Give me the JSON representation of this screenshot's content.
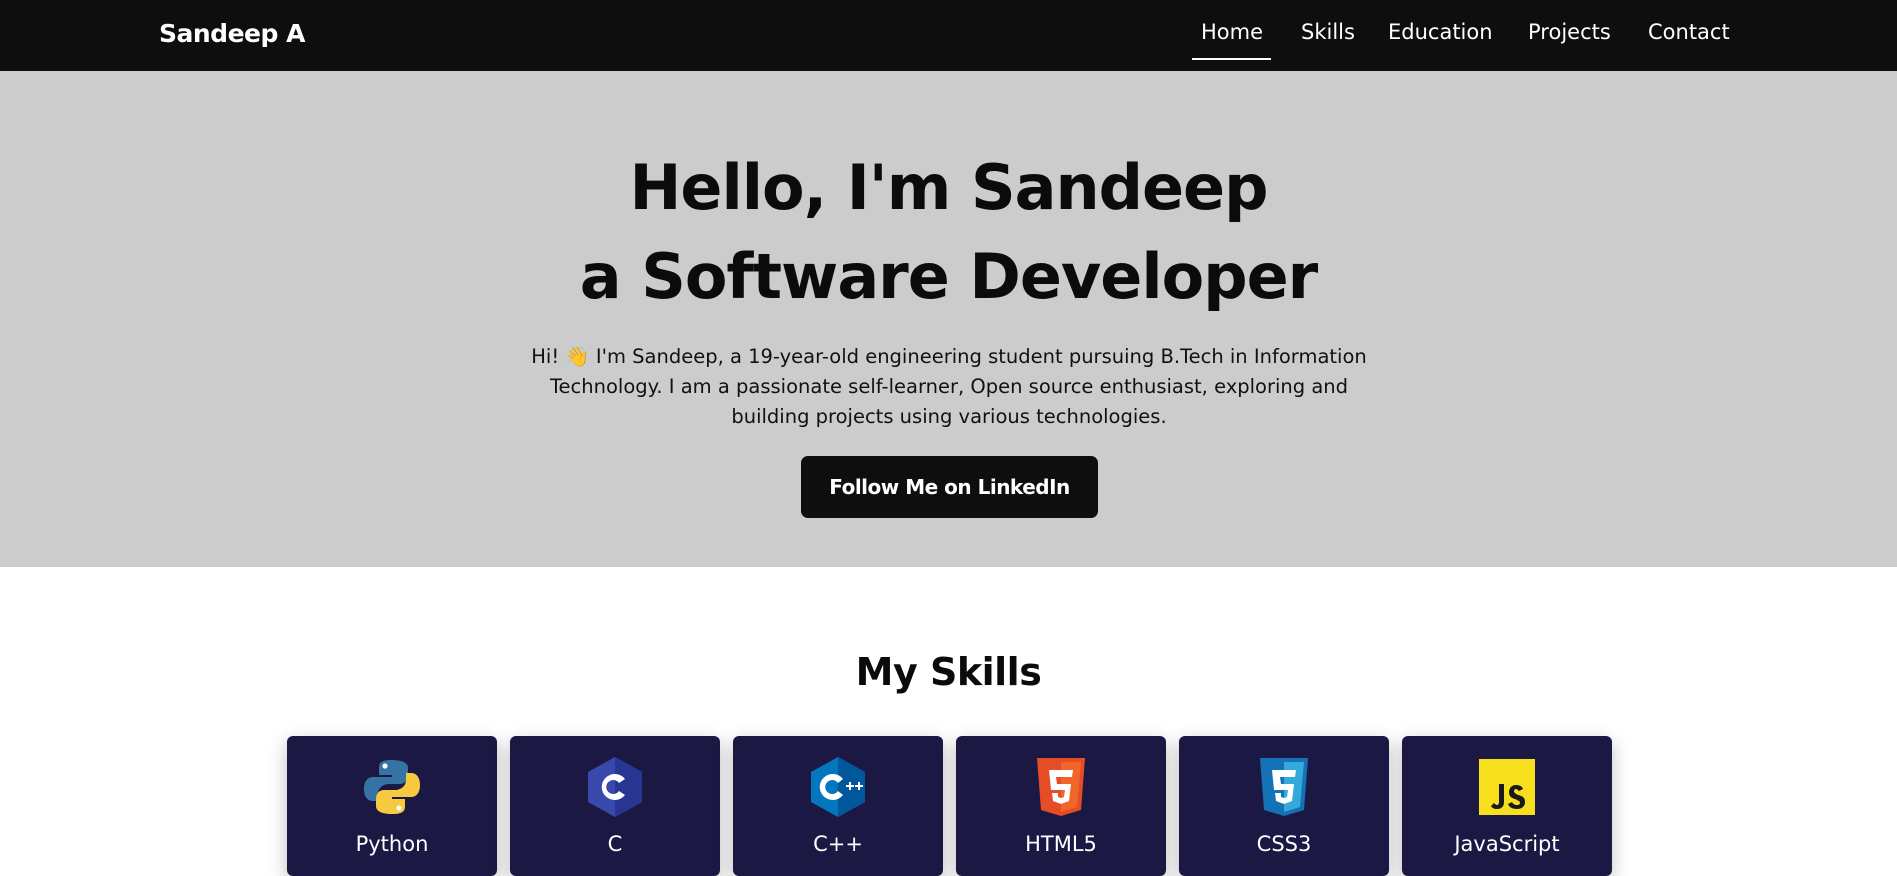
{
  "navbar": {
    "brand": "Sandeep A",
    "links": [
      {
        "label": "Home",
        "active": true
      },
      {
        "label": "Skills"
      },
      {
        "label": "Education"
      },
      {
        "label": "Projects"
      },
      {
        "label": "Contact"
      }
    ]
  },
  "hero": {
    "title_line1": "Hello, I'm Sandeep",
    "title_line2": "a Software Developer",
    "intro_prefix": "Hi!",
    "intro_emoji": "👋",
    "intro_text": "I'm Sandeep, a 19-year-old engineering student pursuing B.Tech in Information Technology. I am a passionate self-learner, Open source enthusiast, exploring and building projects using various technologies.",
    "cta_label": "Follow Me on LinkedIn"
  },
  "skills": {
    "title": "My Skills",
    "items": [
      {
        "label": "Python",
        "icon": "python-icon"
      },
      {
        "label": "C",
        "icon": "c-icon"
      },
      {
        "label": "C++",
        "icon": "cplusplus-icon"
      },
      {
        "label": "HTML5",
        "icon": "html5-icon"
      },
      {
        "label": "CSS3",
        "icon": "css3-icon"
      },
      {
        "label": "JavaScript",
        "icon": "javascript-icon"
      }
    ]
  },
  "colors": {
    "navbar_bg": "#0e0e0e",
    "hero_bg": "#cccccc",
    "card_bg": "#1b1944",
    "cta_bg": "#0e0e0e",
    "text_light": "#ffffff",
    "text_dark": "#0b0b0b"
  }
}
